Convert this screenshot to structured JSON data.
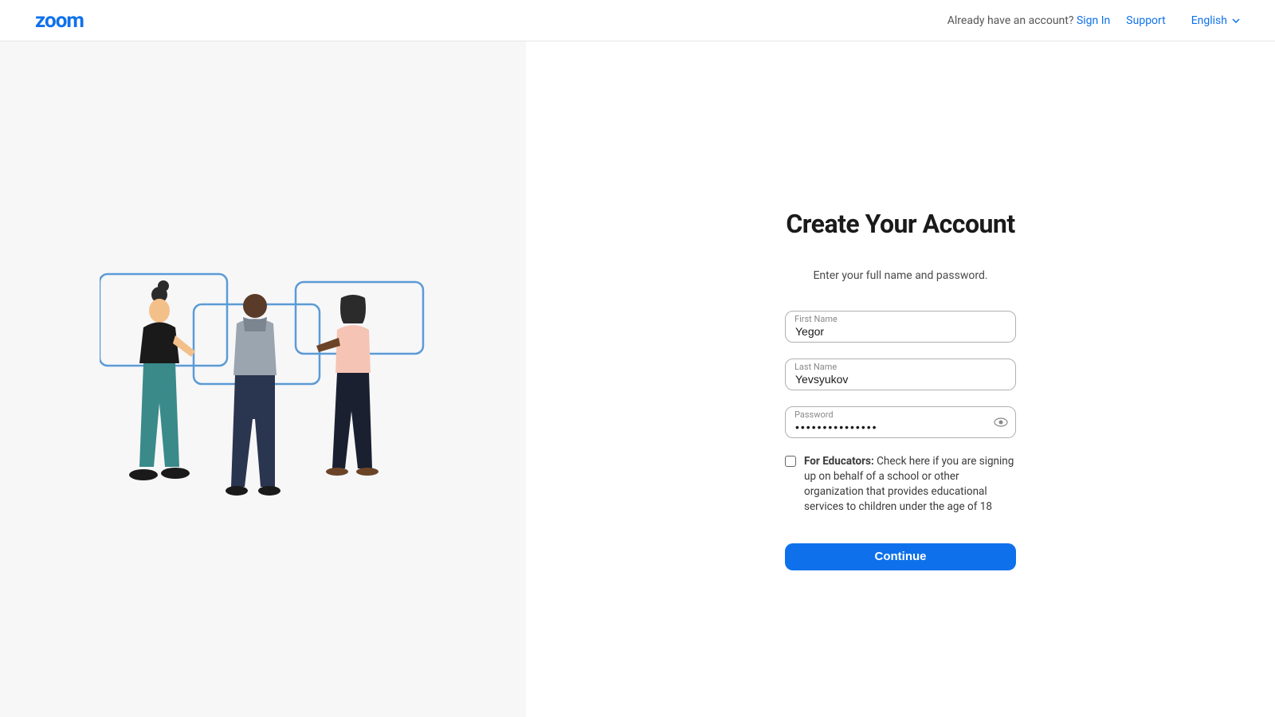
{
  "header": {
    "logo_text": "zoom",
    "already_have_text": "Already have an account?",
    "sign_in_label": "Sign In",
    "support_label": "Support",
    "language_label": "English"
  },
  "form": {
    "title": "Create Your Account",
    "subtitle": "Enter your full name and password.",
    "first_name_label": "First Name",
    "first_name_value": "Yegor",
    "last_name_label": "Last Name",
    "last_name_value": "Yevsyukov",
    "password_label": "Password",
    "password_value": "•••••••••••••••",
    "educators_bold": "For Educators:",
    "educators_text": " Check here if you are signing up on behalf of a school or other organization that provides educational services to children under the age of 18",
    "continue_label": "Continue"
  }
}
